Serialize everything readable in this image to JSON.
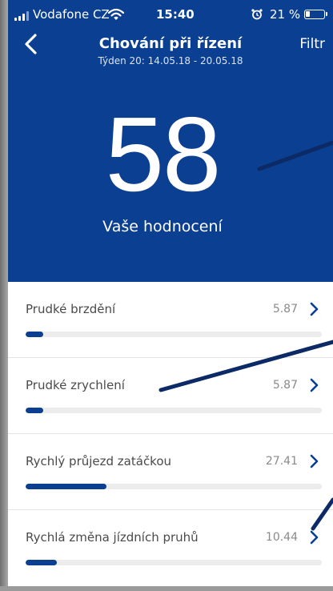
{
  "status_bar": {
    "carrier": "Vodafone CZ",
    "time": "15:40",
    "battery": "21 %",
    "icons": [
      "signal-icon",
      "wifi-icon",
      "alarm-icon",
      "battery-icon"
    ]
  },
  "header": {
    "title": "Chování při řízení",
    "subtitle": "Týden 20: 14.05.18 - 20.05.18",
    "filter_label": "Filtr",
    "back_icon": "chevron-left-icon"
  },
  "score": {
    "value": "58",
    "label": "Vaše hodnocení"
  },
  "metrics": [
    {
      "label": "Prudké brzdění",
      "value": "5.87",
      "level": 0.0587
    },
    {
      "label": "Prudké zrychlení",
      "value": "5.87",
      "level": 0.0587
    },
    {
      "label": "Rychlý průjezd zatáčkou",
      "value": "27.41",
      "level": 0.2741
    },
    {
      "label": "Rychlá změna jízdních pruhů",
      "value": "10.44",
      "level": 0.1044
    }
  ],
  "colors": {
    "brand_blue": "#0b3f91",
    "track": "#ececec",
    "label_text": "#4a4a4a",
    "value_text": "#8a8a8a"
  }
}
